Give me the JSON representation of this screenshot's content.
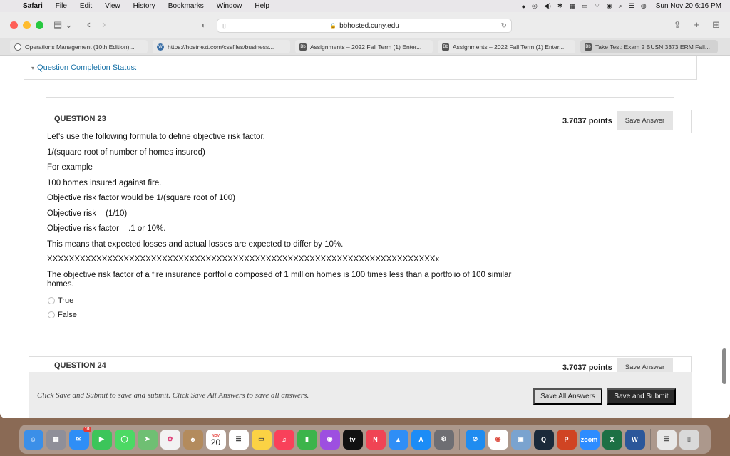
{
  "menubar": {
    "app": "Safari",
    "items": [
      "File",
      "Edit",
      "View",
      "History",
      "Bookmarks",
      "Window",
      "Help"
    ],
    "clock": "Sun Nov 20  6:16 PM"
  },
  "browser": {
    "url": "bbhosted.cuny.edu",
    "tabs": [
      {
        "label": "Operations Management (10th Edition)...",
        "icon": "openai-icon"
      },
      {
        "label": "https://hostnezt.com/cssfiles/business...",
        "icon": "wordpress-icon"
      },
      {
        "label": "Assignments – 2022 Fall Term (1) Enter...",
        "icon": "blackboard-icon"
      },
      {
        "label": "Assignments – 2022 Fall Term (1) Enter...",
        "icon": "blackboard-icon"
      },
      {
        "label": "Take Test: Exam 2 BUSN 3373 ERM Fall...",
        "icon": "blackboard-icon",
        "active": true
      }
    ]
  },
  "test": {
    "completion_status": "Question Completion Status:",
    "question23": {
      "title": "QUESTION 23",
      "points": "3.7037 points",
      "save_label": "Save Answer",
      "lines": [
        "Let's use the following formula to define objective risk factor.",
        "1/(square root of number of homes insured)",
        "For example",
        "100 homes insured against fire.",
        "Objective risk factor would be 1/(square root of 100)",
        "Objective risk = (1/10)",
        "Objective risk factor = .1 or 10%.",
        "This means that expected losses and actual losses are expected to differ by 10%.",
        "XXXXXXXXXXXXXXXXXXXXXXXXXXXXXXXXXXXXXXXXXXXXXXXXXXXXXXXXXXXXXXXXXXXXXXXx",
        "The objective risk factor of a fire insurance portfolio composed of 1 million homes is 100 times less than a portfolio of 100 similar homes."
      ],
      "options": [
        "True",
        "False"
      ]
    },
    "question24": {
      "title": "QUESTION 24",
      "points": "3.7037 points",
      "save_label": "Save Answer"
    },
    "footer": {
      "message": "Click Save and Submit to save and submit. Click Save All Answers to save all answers.",
      "save_all": "Save All Answers",
      "save_submit": "Save and Submit"
    }
  },
  "dock": {
    "mail_badge": "10",
    "calendar_month": "NOV",
    "calendar_day": "20",
    "apps": [
      "finder",
      "launchpad",
      "mail",
      "facetime",
      "messages",
      "maps",
      "photos",
      "contacts",
      "calendar",
      "reminders",
      "notes",
      "music",
      "numbers",
      "podcasts",
      "tv",
      "news",
      "keynote",
      "app-store",
      "system-preferences",
      "safari",
      "chrome",
      "preview",
      "quicktime",
      "powerpoint",
      "zoom",
      "excel",
      "word",
      "downloads",
      "trash"
    ]
  }
}
